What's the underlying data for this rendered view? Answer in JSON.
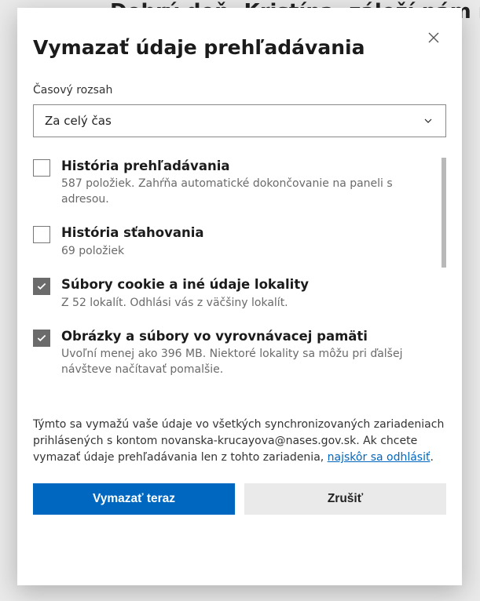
{
  "background": {
    "text": "Dobrý deň, Kristína, záleží nám na"
  },
  "dialog": {
    "title": "Vymazať údaje prehľadávania",
    "timeRange": {
      "label": "Časový rozsah",
      "selected": "Za celý čas"
    },
    "items": [
      {
        "checked": false,
        "title": "História prehľadávania",
        "desc": "587 položiek. Zahŕňa automatické dokončovanie na paneli s adresou."
      },
      {
        "checked": false,
        "title": "História sťahovania",
        "desc": "69 položiek"
      },
      {
        "checked": true,
        "title": "Súbory cookie a iné údaje lokality",
        "desc": "Z 52 lokalít. Odhlási vás z väčšiny lokalít."
      },
      {
        "checked": true,
        "title": "Obrázky a súbory vo vyrovnávacej pamäti",
        "desc": "Uvoľní menej ako 396 MB. Niektoré lokality sa môžu pri ďalšej návšteve načítavať pomalšie."
      }
    ],
    "syncNote": {
      "part1": "Týmto sa vymažú vaše údaje vo všetkých synchronizovaných zariadeniach prihlásených s kontom novanska-krucayova@nases.gov.sk. Ak chcete vymazať údaje prehľadávania len z tohto zariadenia, ",
      "link": "najskôr sa odhlásiť",
      "part2": "."
    },
    "buttons": {
      "primary": "Vymazať teraz",
      "secondary": "Zrušiť"
    }
  }
}
